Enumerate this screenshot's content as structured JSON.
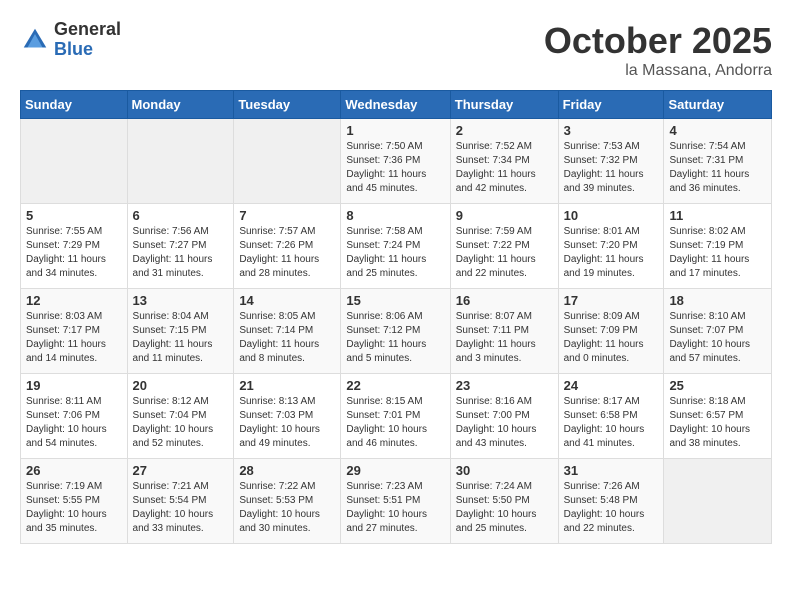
{
  "header": {
    "logo_general": "General",
    "logo_blue": "Blue",
    "month_title": "October 2025",
    "location": "la Massana, Andorra"
  },
  "calendar": {
    "days_of_week": [
      "Sunday",
      "Monday",
      "Tuesday",
      "Wednesday",
      "Thursday",
      "Friday",
      "Saturday"
    ],
    "weeks": [
      [
        {
          "day": "",
          "info": ""
        },
        {
          "day": "",
          "info": ""
        },
        {
          "day": "",
          "info": ""
        },
        {
          "day": "1",
          "info": "Sunrise: 7:50 AM\nSunset: 7:36 PM\nDaylight: 11 hours and 45 minutes."
        },
        {
          "day": "2",
          "info": "Sunrise: 7:52 AM\nSunset: 7:34 PM\nDaylight: 11 hours and 42 minutes."
        },
        {
          "day": "3",
          "info": "Sunrise: 7:53 AM\nSunset: 7:32 PM\nDaylight: 11 hours and 39 minutes."
        },
        {
          "day": "4",
          "info": "Sunrise: 7:54 AM\nSunset: 7:31 PM\nDaylight: 11 hours and 36 minutes."
        }
      ],
      [
        {
          "day": "5",
          "info": "Sunrise: 7:55 AM\nSunset: 7:29 PM\nDaylight: 11 hours and 34 minutes."
        },
        {
          "day": "6",
          "info": "Sunrise: 7:56 AM\nSunset: 7:27 PM\nDaylight: 11 hours and 31 minutes."
        },
        {
          "day": "7",
          "info": "Sunrise: 7:57 AM\nSunset: 7:26 PM\nDaylight: 11 hours and 28 minutes."
        },
        {
          "day": "8",
          "info": "Sunrise: 7:58 AM\nSunset: 7:24 PM\nDaylight: 11 hours and 25 minutes."
        },
        {
          "day": "9",
          "info": "Sunrise: 7:59 AM\nSunset: 7:22 PM\nDaylight: 11 hours and 22 minutes."
        },
        {
          "day": "10",
          "info": "Sunrise: 8:01 AM\nSunset: 7:20 PM\nDaylight: 11 hours and 19 minutes."
        },
        {
          "day": "11",
          "info": "Sunrise: 8:02 AM\nSunset: 7:19 PM\nDaylight: 11 hours and 17 minutes."
        }
      ],
      [
        {
          "day": "12",
          "info": "Sunrise: 8:03 AM\nSunset: 7:17 PM\nDaylight: 11 hours and 14 minutes."
        },
        {
          "day": "13",
          "info": "Sunrise: 8:04 AM\nSunset: 7:15 PM\nDaylight: 11 hours and 11 minutes."
        },
        {
          "day": "14",
          "info": "Sunrise: 8:05 AM\nSunset: 7:14 PM\nDaylight: 11 hours and 8 minutes."
        },
        {
          "day": "15",
          "info": "Sunrise: 8:06 AM\nSunset: 7:12 PM\nDaylight: 11 hours and 5 minutes."
        },
        {
          "day": "16",
          "info": "Sunrise: 8:07 AM\nSunset: 7:11 PM\nDaylight: 11 hours and 3 minutes."
        },
        {
          "day": "17",
          "info": "Sunrise: 8:09 AM\nSunset: 7:09 PM\nDaylight: 11 hours and 0 minutes."
        },
        {
          "day": "18",
          "info": "Sunrise: 8:10 AM\nSunset: 7:07 PM\nDaylight: 10 hours and 57 minutes."
        }
      ],
      [
        {
          "day": "19",
          "info": "Sunrise: 8:11 AM\nSunset: 7:06 PM\nDaylight: 10 hours and 54 minutes."
        },
        {
          "day": "20",
          "info": "Sunrise: 8:12 AM\nSunset: 7:04 PM\nDaylight: 10 hours and 52 minutes."
        },
        {
          "day": "21",
          "info": "Sunrise: 8:13 AM\nSunset: 7:03 PM\nDaylight: 10 hours and 49 minutes."
        },
        {
          "day": "22",
          "info": "Sunrise: 8:15 AM\nSunset: 7:01 PM\nDaylight: 10 hours and 46 minutes."
        },
        {
          "day": "23",
          "info": "Sunrise: 8:16 AM\nSunset: 7:00 PM\nDaylight: 10 hours and 43 minutes."
        },
        {
          "day": "24",
          "info": "Sunrise: 8:17 AM\nSunset: 6:58 PM\nDaylight: 10 hours and 41 minutes."
        },
        {
          "day": "25",
          "info": "Sunrise: 8:18 AM\nSunset: 6:57 PM\nDaylight: 10 hours and 38 minutes."
        }
      ],
      [
        {
          "day": "26",
          "info": "Sunrise: 7:19 AM\nSunset: 5:55 PM\nDaylight: 10 hours and 35 minutes."
        },
        {
          "day": "27",
          "info": "Sunrise: 7:21 AM\nSunset: 5:54 PM\nDaylight: 10 hours and 33 minutes."
        },
        {
          "day": "28",
          "info": "Sunrise: 7:22 AM\nSunset: 5:53 PM\nDaylight: 10 hours and 30 minutes."
        },
        {
          "day": "29",
          "info": "Sunrise: 7:23 AM\nSunset: 5:51 PM\nDaylight: 10 hours and 27 minutes."
        },
        {
          "day": "30",
          "info": "Sunrise: 7:24 AM\nSunset: 5:50 PM\nDaylight: 10 hours and 25 minutes."
        },
        {
          "day": "31",
          "info": "Sunrise: 7:26 AM\nSunset: 5:48 PM\nDaylight: 10 hours and 22 minutes."
        },
        {
          "day": "",
          "info": ""
        }
      ]
    ]
  }
}
